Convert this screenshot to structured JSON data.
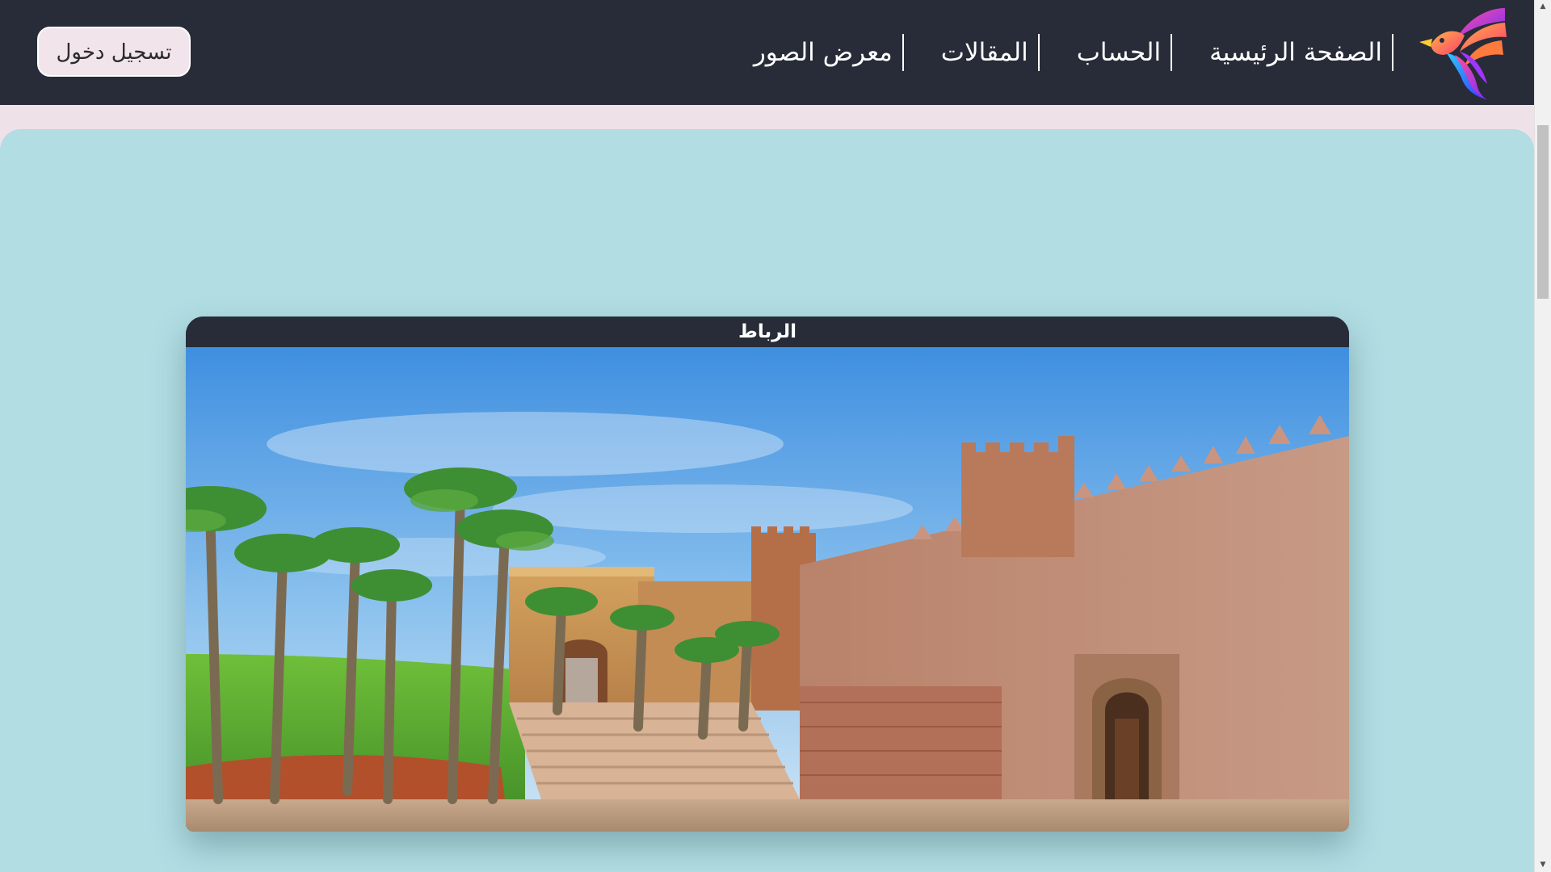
{
  "navbar": {
    "links": [
      {
        "label": "الصفحة الرئيسية"
      },
      {
        "label": "الحساب"
      },
      {
        "label": "المقالات"
      },
      {
        "label": "معرض الصور"
      }
    ],
    "login_label": "تسجيل دخول",
    "logo_icon": "colorful-bird-logo-icon"
  },
  "card": {
    "title": "الرباط",
    "image_icon": "kasbah-oudayas-photo"
  },
  "colors": {
    "navbar_bg": "#282c38",
    "panel_bg": "#b1dde3",
    "page_bg": "#efe1e8",
    "login_bg": "#f1e4ea"
  }
}
